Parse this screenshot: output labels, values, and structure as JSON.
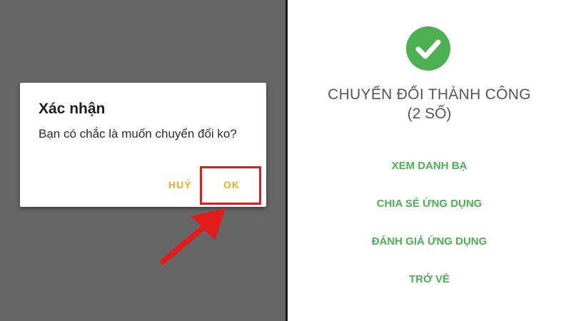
{
  "left": {
    "dialog": {
      "title": "Xác nhận",
      "message": "Bạn có chắc là muốn chuyển đổi ko?",
      "cancel_label": "HUỶ",
      "ok_label": "OK"
    }
  },
  "right": {
    "status_icon": "check-circle-icon",
    "title": "CHUYỂN ĐỔI THÀNH CÔNG",
    "subtitle": "(2 SỐ)",
    "actions": [
      {
        "label": "XEM DANH BẠ"
      },
      {
        "label": "CHIA SẺ ỨNG DỤNG"
      },
      {
        "label": "ĐÁNH GIÁ ỨNG DỤNG"
      },
      {
        "label": "TRỞ VỀ"
      }
    ]
  },
  "colors": {
    "overlay_gray": "#666666",
    "dialog_button": "#f5a623",
    "highlight_red": "#e31b1b",
    "success_green": "#4caf50"
  }
}
